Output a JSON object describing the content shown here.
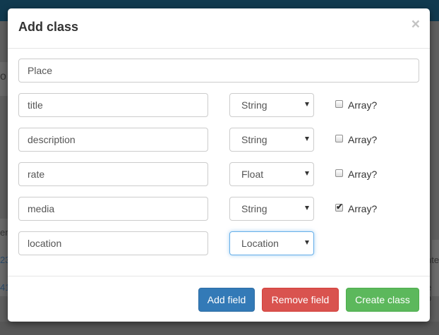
{
  "background": {
    "fragments": [
      "o",
      "er",
      "23",
      "nte",
      "41",
      "e b"
    ]
  },
  "modal": {
    "title": "Add class",
    "close_label": "×",
    "class_name_value": "Place",
    "array_label": "Array?",
    "fields": [
      {
        "name": "title",
        "type": "String",
        "array_checked": false,
        "show_array": true
      },
      {
        "name": "description",
        "type": "String",
        "array_checked": false,
        "show_array": true
      },
      {
        "name": "rate",
        "type": "Float",
        "array_checked": false,
        "show_array": true
      },
      {
        "name": "media",
        "type": "String",
        "array_checked": true,
        "show_array": true
      },
      {
        "name": "location",
        "type": "Location",
        "array_checked": false,
        "show_array": false
      }
    ],
    "buttons": {
      "add_field": "Add field",
      "remove_field": "Remove field",
      "create_class": "Create class"
    }
  }
}
